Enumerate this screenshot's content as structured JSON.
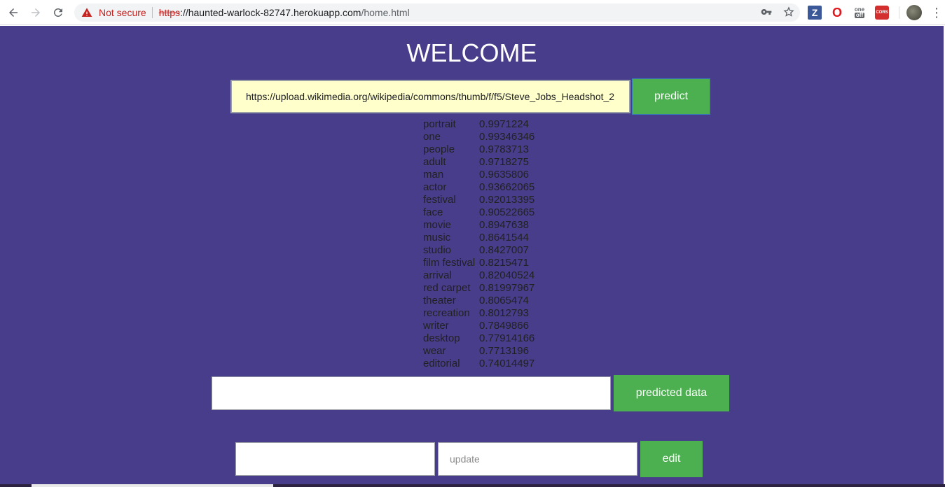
{
  "browser": {
    "security_label": "Not secure",
    "url_scheme": "https",
    "url_host": "://haunted-warlock-82747.herokuapp.com",
    "url_path": "/home.html",
    "extensions": [
      {
        "name": "z-extension",
        "label": "Z"
      },
      {
        "name": "opera-extension",
        "label": "O"
      },
      {
        "name": "off-extension",
        "label_top": "one",
        "label_bottom": "off"
      },
      {
        "name": "cors-extension",
        "label": "CORS"
      }
    ]
  },
  "page": {
    "title": "WELCOME",
    "url_input_value": "https://upload.wikimedia.org/wikipedia/commons/thumb/f/f5/Steve_Jobs_Headshot_2",
    "predict_label": "predict",
    "predicted_input_value": "",
    "predicted_label": "predicted data",
    "edit_input_value": "",
    "update_placeholder": "update",
    "edit_label": "edit"
  },
  "results": [
    {
      "label": "portrait",
      "score": "0.9971224"
    },
    {
      "label": "one",
      "score": "0.99346346"
    },
    {
      "label": "people",
      "score": "0.9783713"
    },
    {
      "label": "adult",
      "score": "0.9718275"
    },
    {
      "label": "man",
      "score": "0.9635806"
    },
    {
      "label": "actor",
      "score": "0.93662065"
    },
    {
      "label": "festival",
      "score": "0.92013395"
    },
    {
      "label": "face",
      "score": "0.90522665"
    },
    {
      "label": "movie",
      "score": "0.8947638"
    },
    {
      "label": "music",
      "score": "0.8641544"
    },
    {
      "label": "studio",
      "score": "0.8427007"
    },
    {
      "label": "film festival",
      "score": "0.8215471"
    },
    {
      "label": "arrival",
      "score": "0.82040524"
    },
    {
      "label": "red carpet",
      "score": "0.81997967"
    },
    {
      "label": "theater",
      "score": "0.8065474"
    },
    {
      "label": "recreation",
      "score": "0.8012793"
    },
    {
      "label": "writer",
      "score": "0.7849866"
    },
    {
      "label": "desktop",
      "score": "0.77914166"
    },
    {
      "label": "wear",
      "score": "0.7713196"
    },
    {
      "label": "editorial",
      "score": "0.74014497"
    }
  ]
}
